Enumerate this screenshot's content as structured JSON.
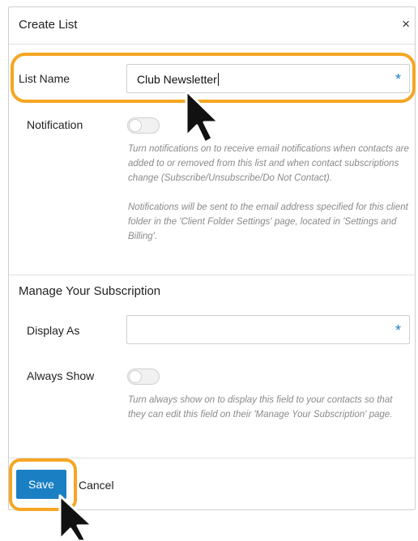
{
  "dialog": {
    "title": "Create List",
    "close_glyph": "×"
  },
  "list_name": {
    "label": "List Name",
    "value": "Club Newsletter",
    "required_mark": "*"
  },
  "notification": {
    "label": "Notification",
    "enabled": false,
    "help_1": "Turn notifications on to receive email notifications when contacts are added to or removed from this list and when contact subscriptions change (Subscribe/Unsubscribe/Do Not Contact).",
    "help_2": "Notifications will be sent to the email address specified for this client folder in the 'Client Folder Settings' page, located in 'Settings and Billing'."
  },
  "manage_subscription": {
    "section_title": "Manage Your Subscription",
    "display_as": {
      "label": "Display As",
      "value": "",
      "required_mark": "*"
    },
    "always_show": {
      "label": "Always Show",
      "enabled": false,
      "help": "Turn always show on to display this field to your contacts so that they can edit this field on their 'Manage Your Subscription' page."
    }
  },
  "footer": {
    "save_label": "Save",
    "cancel_label": "Cancel"
  },
  "colors": {
    "accent": "#1b7fc3",
    "highlight": "#f5a623",
    "required": "#1e82c4"
  },
  "icons": {
    "close": "close-icon",
    "pointer": "mouse-pointer-icon"
  }
}
